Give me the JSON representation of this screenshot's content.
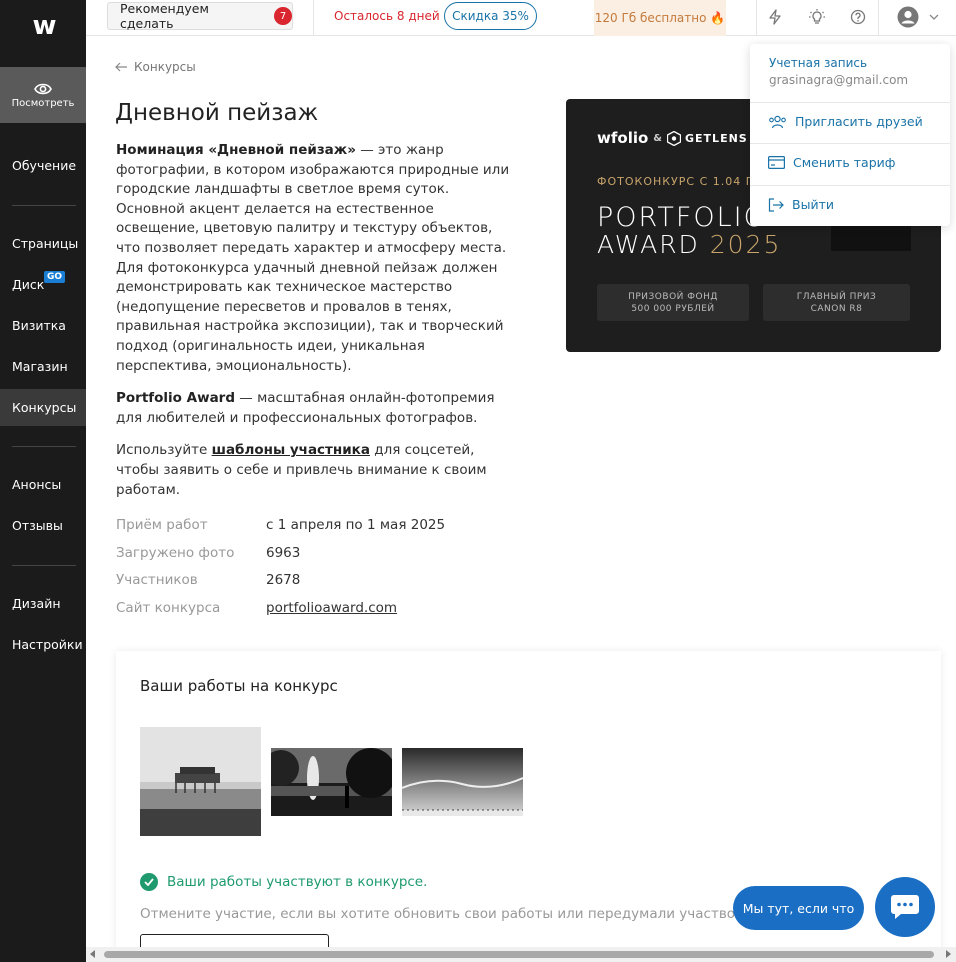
{
  "sidebar": {
    "logo": "w",
    "preview_label": "Посмотреть",
    "items": [
      {
        "label": "Обучение"
      },
      {
        "label": "Страницы"
      },
      {
        "label": "Диск",
        "badge": "GO"
      },
      {
        "label": "Визитка"
      },
      {
        "label": "Магазин"
      },
      {
        "label": "Конкурсы",
        "active": true
      },
      {
        "label": "Анонсы"
      },
      {
        "label": "Отзывы"
      },
      {
        "label": "Дизайн"
      },
      {
        "label": "Настройки"
      }
    ]
  },
  "topbar": {
    "recommend_label": "Рекомендуем сделать",
    "recommend_count": "7",
    "days_left": "Осталось 8 дней",
    "discount": "Скидка 35%",
    "free_storage": "120 Гб бесплатно 🔥"
  },
  "page": {
    "back_label": "Конкурсы",
    "title": "Дневной пейзаж",
    "desc_bold": "Номинация «Дневной пейзаж»",
    "desc_rest": " — это жанр фотографии, в котором изображаются природные или городские ландшафты в светлое время суток. Основной акцент делается на естественное освещение, цветовую палитру и текстуру объектов, что позволяет передать характер и атмосферу места. Для фотоконкурса удачный дневной пейзаж должен демонстрировать как техническое мастерство (недопущение пересветов и провалов в тенях, правильная настройка экспозиции), так и творческий подход (оригинальность идеи, уникальная перспектива, эмоциональность).",
    "award_bold": "Portfolio Award",
    "award_rest": " — масштабная онлайн-фотопремия для любителей и профессиональных фотографов.",
    "templates_pre": "Используйте ",
    "templates_link": "шаблоны участника",
    "templates_post": " для соцсетей, чтобы заявить о себе и привлечь внимание к своим работам.",
    "info": [
      {
        "label": "Приём работ",
        "value": "с 1 апреля по 1 мая 2025"
      },
      {
        "label": "Загружено фото",
        "value": "6963"
      },
      {
        "label": "Участников",
        "value": "2678"
      },
      {
        "label": "Сайт конкурса",
        "value": "portfolioaward.com"
      }
    ]
  },
  "banner": {
    "brand": "wfolio",
    "amp": "&",
    "partner": "GETLENS",
    "subtitle": "ФОТОКОНКУРС С 1.04 П",
    "title1": "PORTFOLIO",
    "title2_word": "AWARD",
    "title2_year": "2025",
    "box1_line1": "ПРИЗОВОЙ ФОНД",
    "box1_line2": "500 000 РУБЛЕЙ",
    "box2_line1": "ГЛАВНЫЙ ПРИЗ",
    "box2_line2": "CANON R8"
  },
  "works": {
    "title": "Ваши работы на конкурс",
    "status": "Ваши работы участвуют в конкурсе.",
    "cancel_text": "Отмените участие, если вы хотите обновить свои работы или передумали участвовать."
  },
  "dropdown": {
    "account_label": "Учетная запись",
    "email": "grasinagra@gmail.com",
    "invite": "Пригласить друзей",
    "change_plan": "Сменить тариф",
    "logout": "Выйти"
  },
  "chat": {
    "label": "Мы тут, если что"
  },
  "colors": {
    "accent": "#1a73a8",
    "chat_blue": "#1a6fc4",
    "success": "#1e9a6e",
    "danger": "#d9262f",
    "gold": "#c9a56b"
  }
}
